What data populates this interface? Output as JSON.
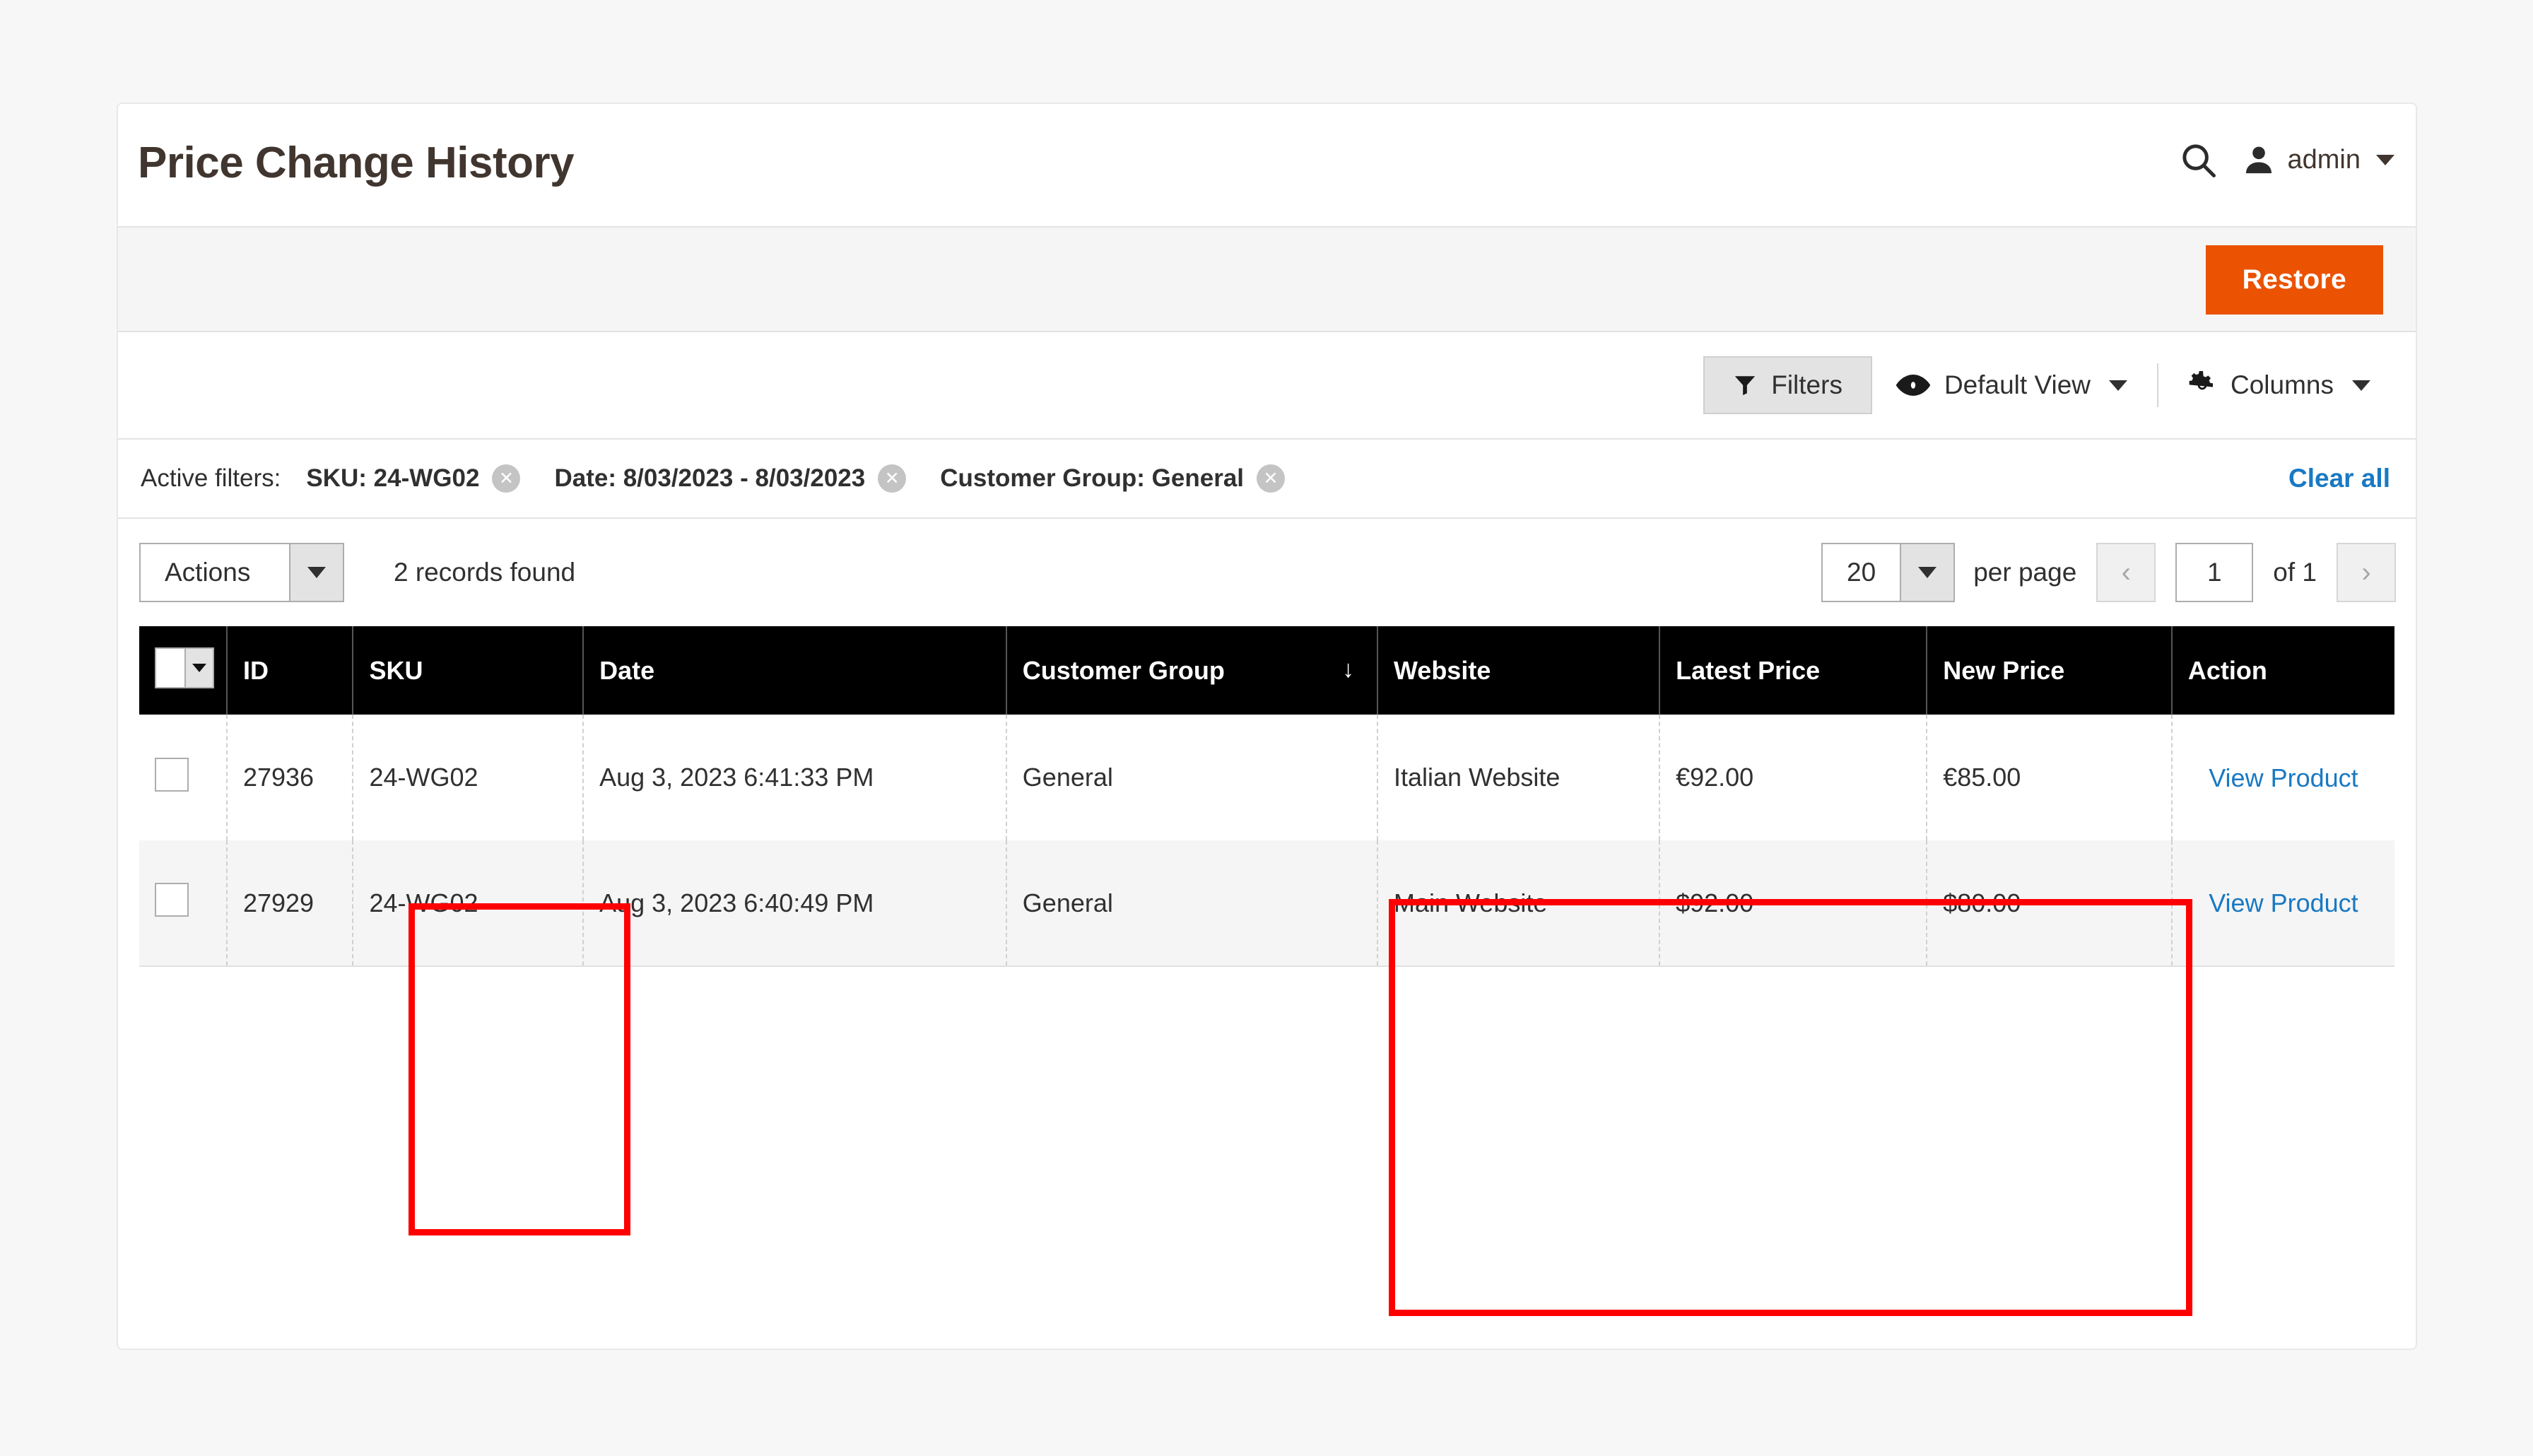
{
  "header": {
    "title": "Price Change History",
    "search_icon": "search-icon",
    "user_icon": "user-avatar-icon",
    "user_name": "admin",
    "user_caret": "chevron-down-icon"
  },
  "action_bar": {
    "restore_label": "Restore",
    "restore_color": "#eb5202"
  },
  "toolbar": {
    "filters_label": "Filters",
    "filters_icon": "funnel-icon",
    "view_label": "Default View",
    "view_icon": "eye-icon",
    "columns_label": "Columns",
    "columns_icon": "gear-icon"
  },
  "active_filters": {
    "label": "Active filters:",
    "clear_all_label": "Clear all",
    "clear_all_color": "#1979c3",
    "chips": [
      {
        "text": "SKU: 24-WG02",
        "remove_icon": "close-circle-icon"
      },
      {
        "text": "Date: 8/03/2023 - 8/03/2023",
        "remove_icon": "close-circle-icon"
      },
      {
        "text": "Customer Group: General",
        "remove_icon": "close-circle-icon"
      }
    ]
  },
  "grid_controls": {
    "actions_label": "Actions",
    "records_found": "2 records found",
    "per_page_value": "20",
    "per_page_label": "per page",
    "prev_icon": "chevron-left-icon",
    "next_icon": "chevron-right-icon",
    "page_value": "1",
    "of_pages": "of 1"
  },
  "table": {
    "columns": [
      {
        "key": "checkbox",
        "label": ""
      },
      {
        "key": "id",
        "label": "ID"
      },
      {
        "key": "sku",
        "label": "SKU"
      },
      {
        "key": "date",
        "label": "Date"
      },
      {
        "key": "customer_group",
        "label": "Customer Group",
        "sort": "↓"
      },
      {
        "key": "website",
        "label": "Website"
      },
      {
        "key": "latest_price",
        "label": "Latest Price"
      },
      {
        "key": "new_price",
        "label": "New Price"
      },
      {
        "key": "action",
        "label": "Action"
      }
    ],
    "rows": [
      {
        "id": "27936",
        "sku": "24-WG02",
        "date": "Aug 3, 2023 6:41:33 PM",
        "customer_group": "General",
        "website": "Italian Website",
        "latest_price": "€92.00",
        "new_price": "€85.00",
        "action": "View Product"
      },
      {
        "id": "27929",
        "sku": "24-WG02",
        "date": "Aug 3, 2023 6:40:49 PM",
        "customer_group": "General",
        "website": "Main Website",
        "latest_price": "$92.00",
        "new_price": "$80.00",
        "action": "View Product"
      }
    ]
  },
  "annotations": {
    "color": "#ff0000",
    "boxes": [
      {
        "name": "sku-column-highlight"
      },
      {
        "name": "website-prices-highlight"
      }
    ]
  }
}
